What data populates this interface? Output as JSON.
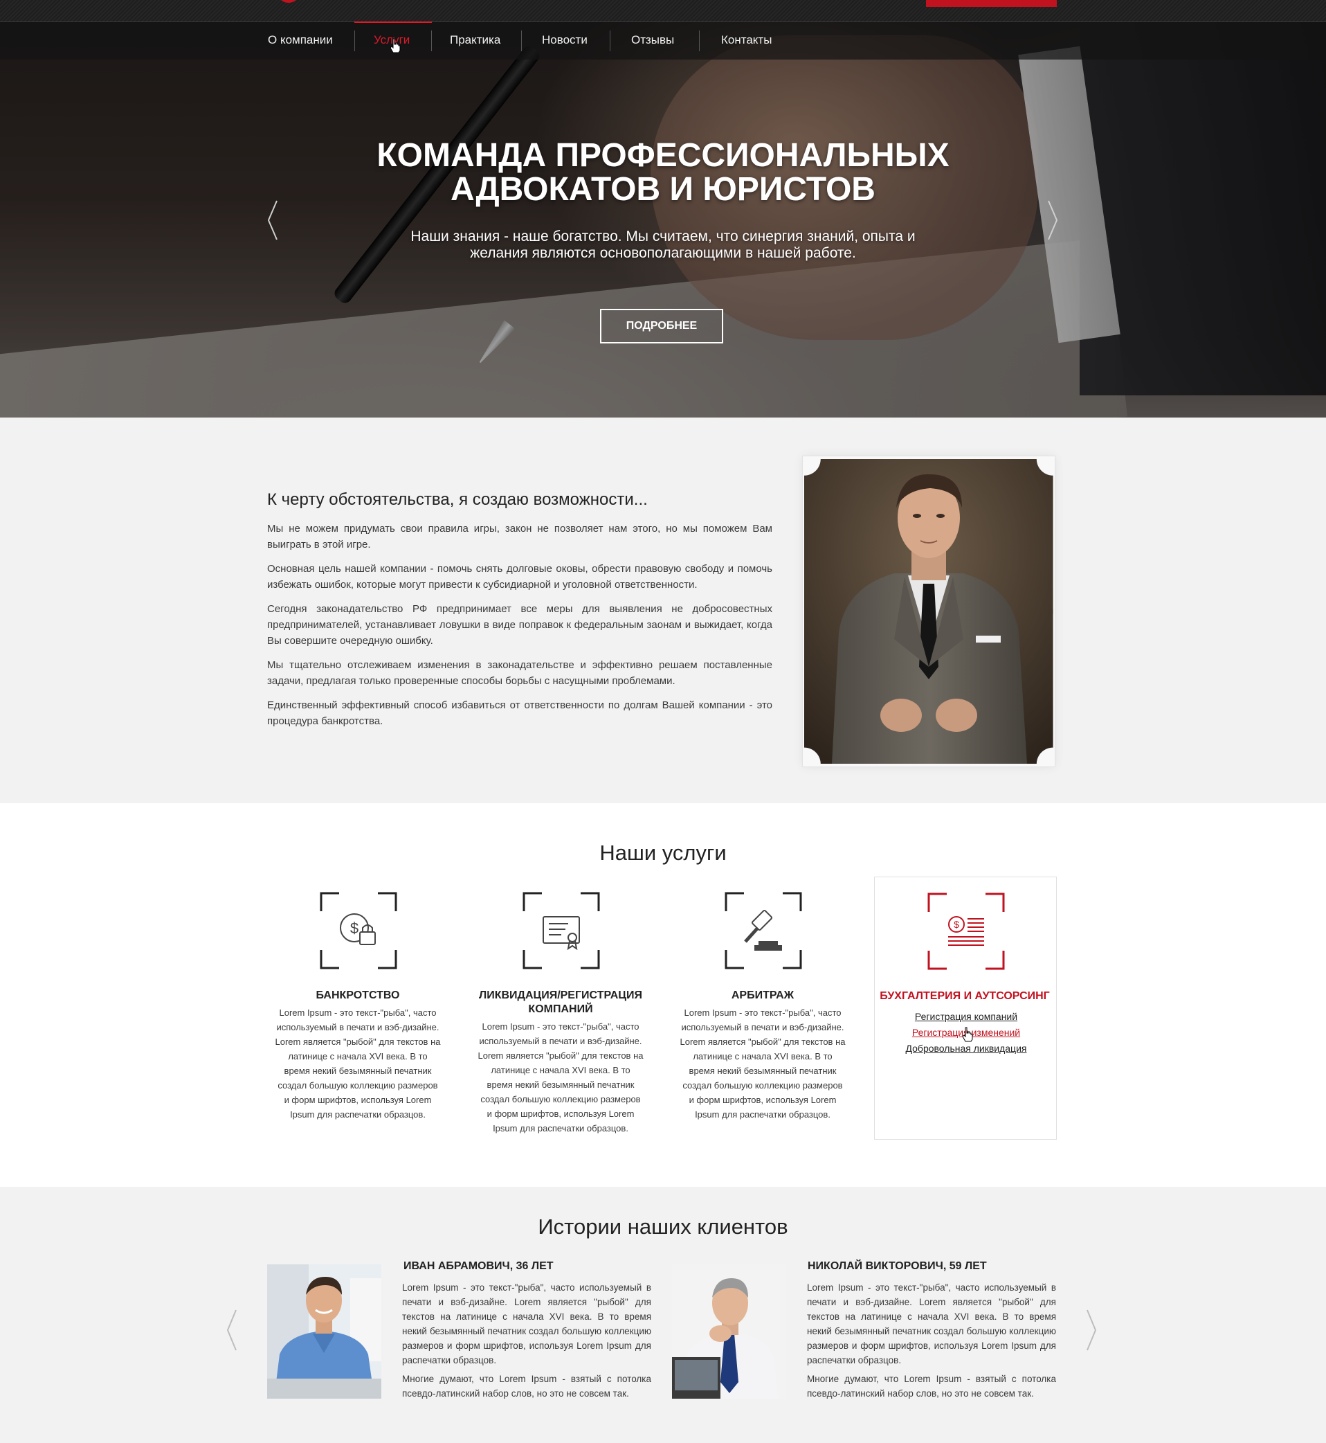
{
  "colors": {
    "accent": "#c1121f",
    "dark": "#1e1e1e",
    "light_bg": "#f2f2f2"
  },
  "nav": {
    "items": [
      "О компании",
      "Услуги",
      "Практика",
      "Новости",
      "Отзывы",
      "Контакты"
    ],
    "active_index": 1
  },
  "hero": {
    "title_line1": "КОМАНДА ПРОФЕССИОНАЛЬНЫХ",
    "title_line2": "АДВОКАТОВ И ЮРИСТОВ",
    "subtitle_line1": "Наши знания - наше богатство. Мы считаем, что синергия знаний, опыта и",
    "subtitle_line2": "желания являются основополагающими в нашей работе.",
    "button_label": "ПОДРОБНЕЕ"
  },
  "about": {
    "title": "К черту обстоятельства, я создаю возможности...",
    "paragraphs": [
      "Мы не можем придумать свои правила игры, закон не позволяет нам этого, но мы поможем Вам выиграть в этой игре.",
      "Основная цель нашей компании - помочь снять долговые оковы, обрести правовую свободу и помочь избежать ошибок, которые могут привести к субсидиарной и уголовной ответственности.",
      "Сегодня законадательство РФ предпринимает все меры для выявления не добросовестных предпринимателей, устанавливает ловушки в виде поправок к федеральным заонам и выжидает, когда Вы совершите очередную ошибку.",
      "Мы тщательно отслеживаем изменения в законадательстве и эффективно решаем поставленные задачи, предлагая только проверенные способы борьбы с насущными проблемами.",
      "Единственный эффективный способ избавиться от ответственности по долгам Вашей компании - это процедура банкротства."
    ]
  },
  "services": {
    "title": "Наши услуги",
    "items": [
      {
        "icon": "money-lock-icon",
        "title": "БАНКРОТСТВО",
        "text": "Lorem Ipsum - это текст-\"рыба\", часто используемый в печати и вэб-дизайне. Lorem является \"рыбой\" для текстов на латинице с начала XVI века. В то время некий безымянный печатник создал большую коллекцию размеров и форм шрифтов, используя Lorem Ipsum для распечатки образцов."
      },
      {
        "icon": "certificate-icon",
        "title": "ЛИКВИДАЦИЯ/РЕГИСТРАЦИЯ КОМПАНИЙ",
        "text": "Lorem Ipsum - это текст-\"рыба\", часто используемый в печати и вэб-дизайне. Lorem является \"рыбой\" для текстов на латинице с начала XVI века. В то время некий безымянный печатник создал большую коллекцию размеров и форм шрифтов, используя Lorem Ipsum для распечатки образцов."
      },
      {
        "icon": "gavel-icon",
        "title": "АРБИТРАЖ",
        "text": "Lorem Ipsum - это текст-\"рыба\", часто используемый в печати и вэб-дизайне. Lorem является \"рыбой\" для текстов на латинице с начала XVI века. В то время некий безымянный печатник создал большую коллекцию размеров и форм шрифтов, используя Lorem Ipsum для распечатки образцов."
      },
      {
        "icon": "accounting-document-icon",
        "title": "БУХГАЛТЕРИЯ И АУТСОРСИНГ",
        "links": [
          "Регистрация компаний",
          "Регистрация изменений",
          "Добровольная ликвидация"
        ]
      }
    ]
  },
  "stories": {
    "title": "Истории наших клиентов",
    "items": [
      {
        "name": "ИВАН АБРАМОВИЧ, 36 ЛЕТ",
        "p1": "Lorem Ipsum - это текст-\"рыба\", часто используемый в печати и вэб-дизайне. Lorem является \"рыбой\" для текстов на латинице с начала XVI века. В то время некий безымянный печатник создал большую коллекцию размеров и форм шрифтов, используя Lorem Ipsum для распечатки образцов.",
        "p2": "Многие думают, что Lorem Ipsum - взятый с потолка псевдо-латинский набор слов, но это не совсем так."
      },
      {
        "name": "НИКОЛАЙ ВИКТОРОВИЧ, 59 ЛЕТ",
        "p1": "Lorem Ipsum - это текст-\"рыба\", часто используемый в печати и вэб-дизайне. Lorem является \"рыбой\" для текстов на латинице с начала XVI века. В то время некий безымянный печатник создал большую коллекцию размеров и форм шрифтов, используя Lorem Ipsum для распечатки образцов.",
        "p2": "Многие думают, что Lorem Ipsum - взятый с потолка псевдо-латинский набор слов, но это не совсем так."
      }
    ]
  }
}
